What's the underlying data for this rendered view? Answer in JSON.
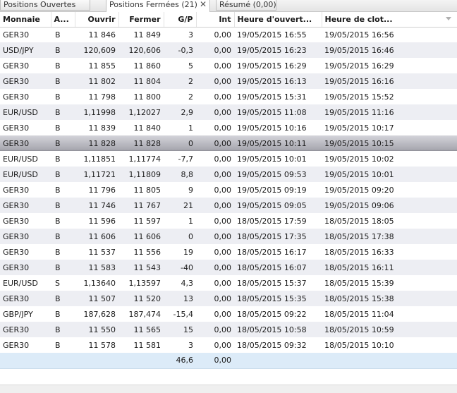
{
  "tabs": [
    {
      "label": "Positions Ouvertes"
    },
    {
      "label": "Positions Fermées (21)",
      "close": "✕"
    },
    {
      "label": "Résumé (0,00)"
    }
  ],
  "columns": [
    "Monnaie",
    "A...",
    "Ouvrir",
    "Fermer",
    "G/P",
    "Int",
    "Heure d'ouvert...",
    "Heure de clot..."
  ],
  "rows": [
    [
      "GER30",
      "B",
      "11 846",
      "11 849",
      "3",
      "0,00",
      "19/05/2015 16:55",
      "19/05/2015 16:56"
    ],
    [
      "USD/JPY",
      "B",
      "120,609",
      "120,606",
      "-0,3",
      "0,00",
      "19/05/2015 16:23",
      "19/05/2015 16:46"
    ],
    [
      "GER30",
      "B",
      "11 855",
      "11 860",
      "5",
      "0,00",
      "19/05/2015 16:29",
      "19/05/2015 16:29"
    ],
    [
      "GER30",
      "B",
      "11 802",
      "11 804",
      "2",
      "0,00",
      "19/05/2015 16:13",
      "19/05/2015 16:16"
    ],
    [
      "GER30",
      "B",
      "11 798",
      "11 800",
      "2",
      "0,00",
      "19/05/2015 15:31",
      "19/05/2015 15:52"
    ],
    [
      "EUR/USD",
      "B",
      "1,11998",
      "1,12027",
      "2,9",
      "0,00",
      "19/05/2015 11:08",
      "19/05/2015 11:16"
    ],
    [
      "GER30",
      "B",
      "11 839",
      "11 840",
      "1",
      "0,00",
      "19/05/2015 10:16",
      "19/05/2015 10:17"
    ],
    [
      "GER30",
      "B",
      "11 828",
      "11 828",
      "0",
      "0,00",
      "19/05/2015 10:11",
      "19/05/2015 10:15"
    ],
    [
      "EUR/USD",
      "B",
      "1,11851",
      "1,11774",
      "-7,7",
      "0,00",
      "19/05/2015 10:01",
      "19/05/2015 10:02"
    ],
    [
      "EUR/USD",
      "B",
      "1,11721",
      "1,11809",
      "8,8",
      "0,00",
      "19/05/2015 09:53",
      "19/05/2015 10:01"
    ],
    [
      "GER30",
      "B",
      "11 796",
      "11 805",
      "9",
      "0,00",
      "19/05/2015 09:19",
      "19/05/2015 09:20"
    ],
    [
      "GER30",
      "B",
      "11 746",
      "11 767",
      "21",
      "0,00",
      "19/05/2015 09:05",
      "19/05/2015 09:06"
    ],
    [
      "GER30",
      "B",
      "11 596",
      "11 597",
      "1",
      "0,00",
      "18/05/2015 17:59",
      "18/05/2015 18:05"
    ],
    [
      "GER30",
      "B",
      "11 606",
      "11 606",
      "0",
      "0,00",
      "18/05/2015 17:35",
      "18/05/2015 17:38"
    ],
    [
      "GER30",
      "B",
      "11 537",
      "11 556",
      "19",
      "0,00",
      "18/05/2015 16:17",
      "18/05/2015 16:33"
    ],
    [
      "GER30",
      "B",
      "11 583",
      "11 543",
      "-40",
      "0,00",
      "18/05/2015 16:07",
      "18/05/2015 16:11"
    ],
    [
      "EUR/USD",
      "S",
      "1,13640",
      "1,13597",
      "4,3",
      "0,00",
      "18/05/2015 15:37",
      "18/05/2015 15:39"
    ],
    [
      "GER30",
      "B",
      "11 507",
      "11 520",
      "13",
      "0,00",
      "18/05/2015 15:35",
      "18/05/2015 15:38"
    ],
    [
      "GBP/JPY",
      "B",
      "187,628",
      "187,474",
      "-15,4",
      "0,00",
      "18/05/2015 09:22",
      "18/05/2015 11:04"
    ],
    [
      "GER30",
      "B",
      "11 550",
      "11 565",
      "15",
      "0,00",
      "18/05/2015 10:58",
      "18/05/2015 10:59"
    ],
    [
      "GER30",
      "B",
      "11 578",
      "11 581",
      "3",
      "0,00",
      "18/05/2015 09:32",
      "18/05/2015 10:10"
    ]
  ],
  "selected_row_index": 7,
  "totals": {
    "gp": "46,6",
    "int": "0,00"
  },
  "colors": {
    "selected_row": "#a8a8b0",
    "alt_row": "#edeef3",
    "totals_row": "#dcebf8"
  }
}
